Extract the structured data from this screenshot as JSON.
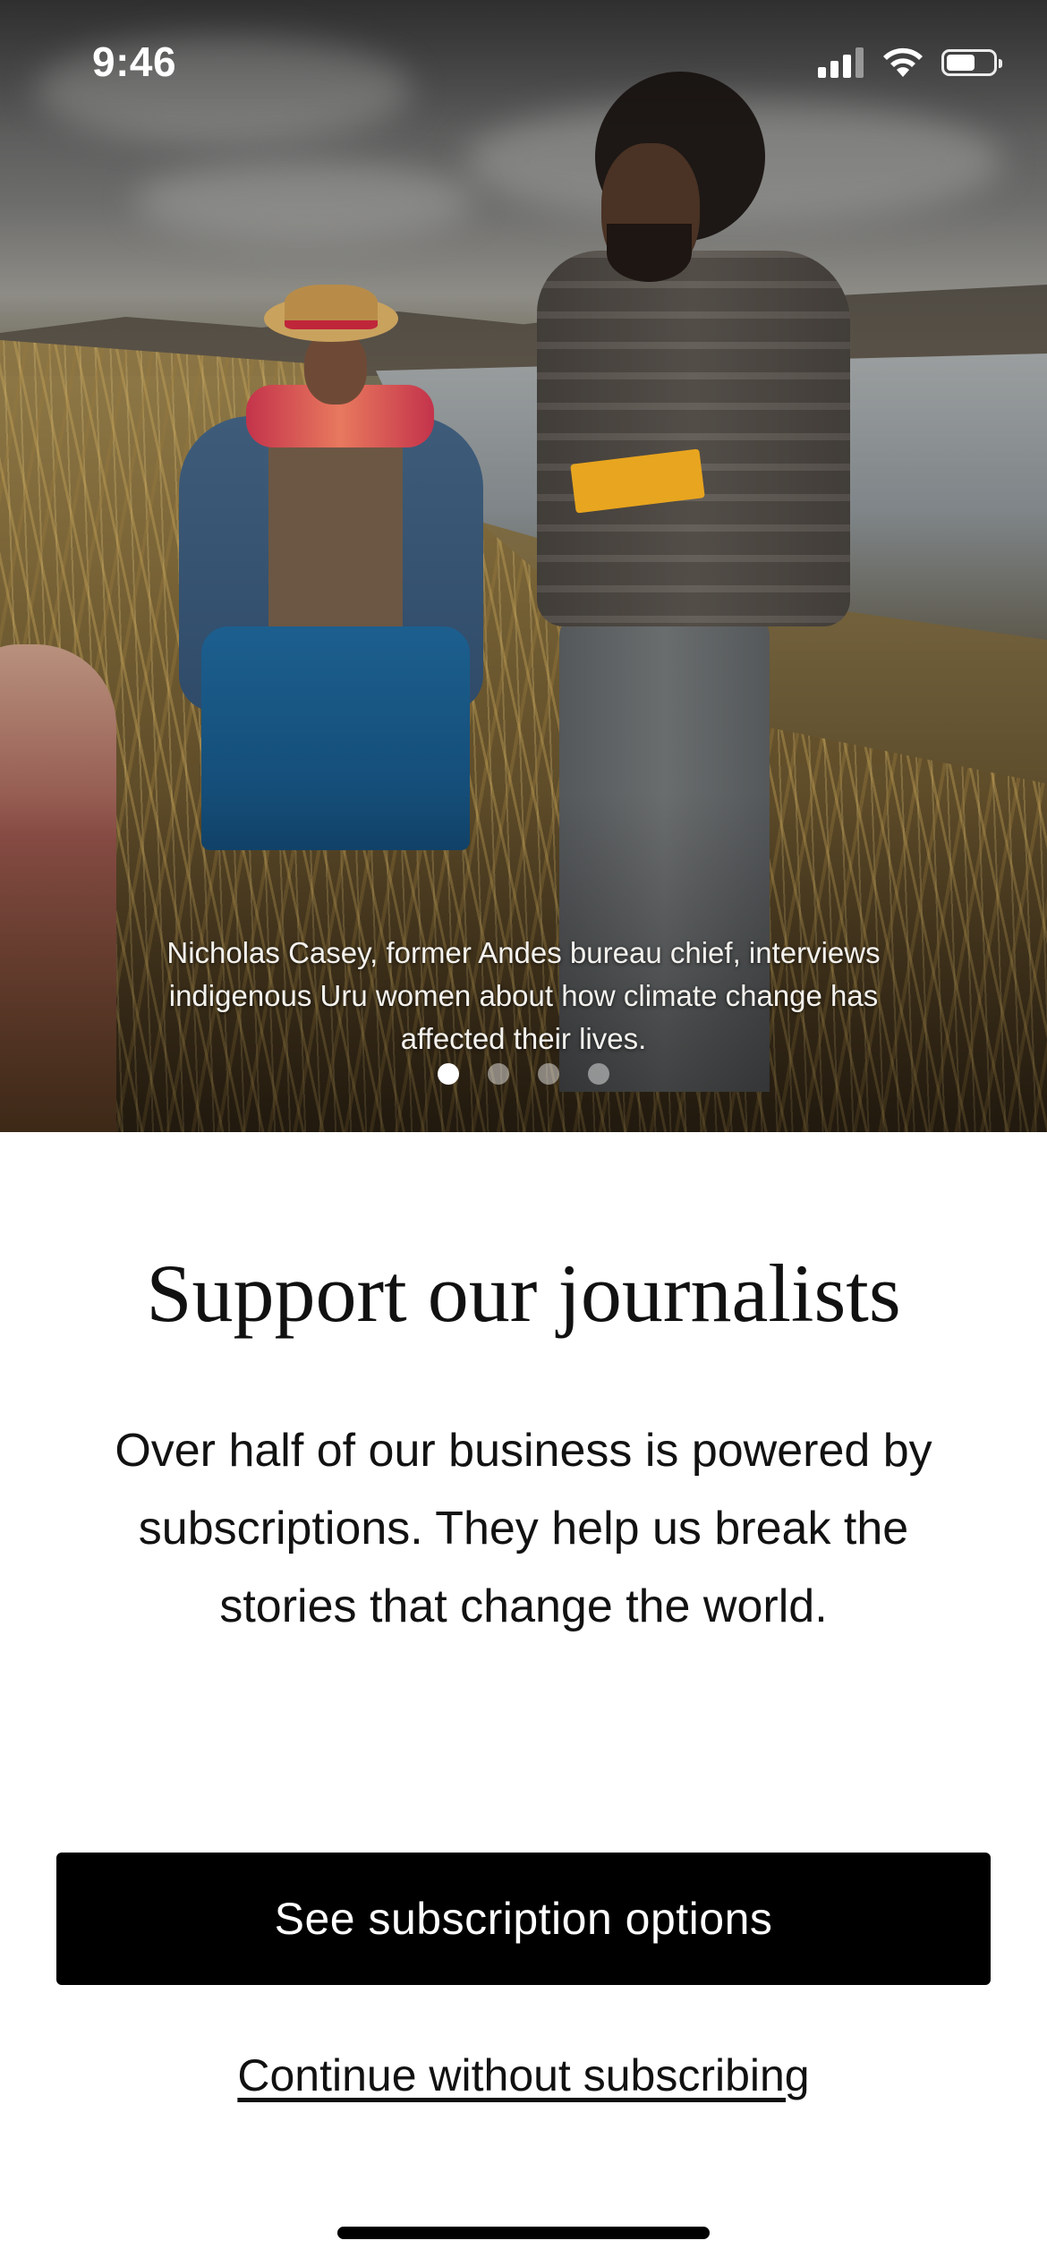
{
  "status_bar": {
    "time": "9:46",
    "icons": [
      "cellular-signal-icon",
      "wifi-icon",
      "battery-icon"
    ],
    "battery_level": 0.55
  },
  "hero": {
    "image_description_icon": "photo",
    "caption": "Nicholas Casey, former Andes bureau chief, interviews indigenous Uru women about how climate change has affected their lives.",
    "carousel": {
      "page_count": 4,
      "active_page": 1
    }
  },
  "main": {
    "headline": "Support our journalists",
    "body": "Over half of our business is powered by subscriptions. They help us break the stories that change the world.",
    "primary_button_label": "See subscription options",
    "secondary_link_label": "Continue without subscribing"
  },
  "colors": {
    "primary_button_bg": "#000000",
    "primary_button_text": "#ffffff",
    "page_bg": "#ffffff",
    "text": "#121212"
  }
}
